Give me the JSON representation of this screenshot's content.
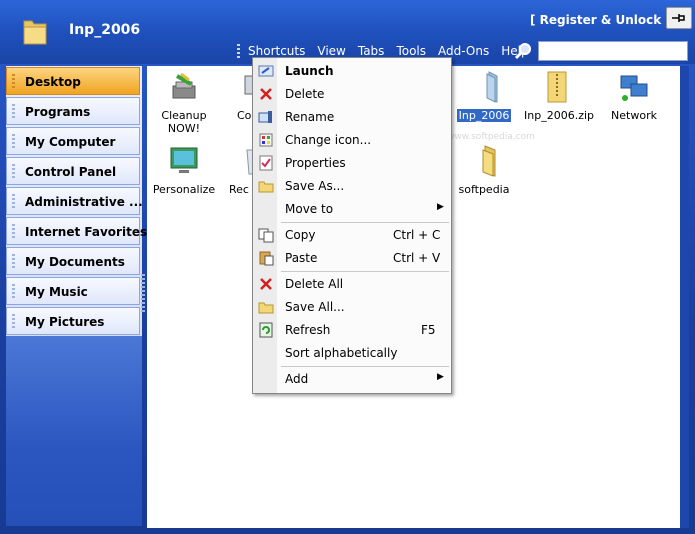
{
  "app": {
    "title": "Inp_2006",
    "register_label": "[ Register & Unlock ]",
    "pin_icon": "pin-icon"
  },
  "menubar": {
    "items": [
      "Shortcuts",
      "View",
      "Tabs",
      "Tools",
      "Add-Ons",
      "Help"
    ]
  },
  "search": {
    "value": ""
  },
  "sidebar": {
    "items": [
      "Desktop",
      "Programs",
      "My Computer",
      "Control Panel",
      "Administrative ...",
      "Internet Favorites",
      "My Documents",
      "My Music",
      "My Pictures"
    ],
    "active": "Desktop"
  },
  "files": {
    "items": [
      {
        "label": "Cleanup NOW!",
        "icon": "cleanup-icon"
      },
      {
        "label": "Co",
        "icon": "computer-icon"
      },
      {
        "label": "Inp_2006",
        "icon": "folder-icon",
        "selected": true
      },
      {
        "label": "Inp_2006.zip",
        "icon": "zip-folder-icon"
      },
      {
        "label": "Network",
        "icon": "network-icon"
      },
      {
        "label": "Personalize",
        "icon": "personalize-icon"
      },
      {
        "label": "Rec",
        "icon": "recycle-bin-icon"
      },
      {
        "label": "softpedia",
        "icon": "folder-icon"
      }
    ]
  },
  "context_menu": {
    "launch": "Launch",
    "delete": "Delete",
    "rename": "Rename",
    "change_icon": "Change icon...",
    "properties": "Properties",
    "save_as": "Save As...",
    "move_to": "Move to",
    "copy": "Copy",
    "copy_shortcut": "Ctrl + C",
    "paste": "Paste",
    "paste_shortcut": "Ctrl + V",
    "delete_all": "Delete All",
    "save_all": "Save All...",
    "refresh": "Refresh",
    "refresh_shortcut": "F5",
    "sort_alpha": "Sort alphabetically",
    "add": "Add"
  },
  "watermark": "SOFTPEDIA",
  "watermark_url": "www.softpedia.com",
  "colors": {
    "accent": "#2c66d8",
    "active_tab": "#f0a422",
    "selection": "#3169c6"
  }
}
